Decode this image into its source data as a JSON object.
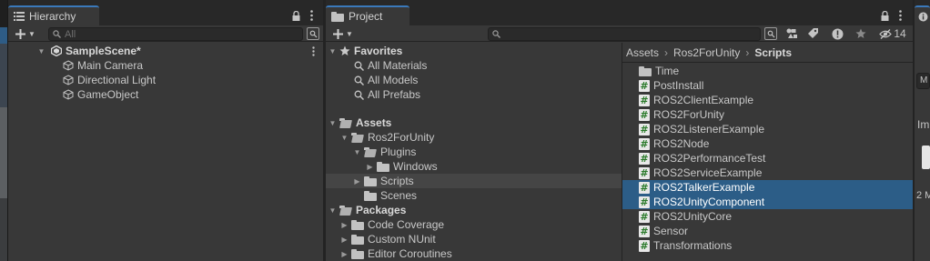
{
  "hierarchy": {
    "tab_label": "Hierarchy",
    "search_placeholder": "All",
    "scene_name": "SampleScene*",
    "objects": [
      "Main Camera",
      "Directional Light",
      "GameObject"
    ]
  },
  "project": {
    "tab_label": "Project",
    "search_value": "",
    "hidden_count": "14",
    "favorites": {
      "label": "Favorites",
      "items": [
        "All Materials",
        "All Models",
        "All Prefabs"
      ]
    },
    "assets": {
      "label": "Assets",
      "tree": {
        "ros2forunity": "Ros2ForUnity",
        "plugins": "Plugins",
        "windows": "Windows",
        "scripts": "Scripts",
        "scenes": "Scenes"
      }
    },
    "packages": {
      "label": "Packages",
      "items": [
        "Code Coverage",
        "Custom NUnit",
        "Editor Coroutines"
      ]
    },
    "breadcrumb": {
      "root": "Assets",
      "middle": "Ros2ForUnity",
      "current": "Scripts"
    },
    "files": [
      {
        "name": "Time",
        "type": "folder",
        "selected": false
      },
      {
        "name": "PostInstall",
        "type": "script",
        "selected": false
      },
      {
        "name": "ROS2ClientExample",
        "type": "script",
        "selected": false
      },
      {
        "name": "ROS2ForUnity",
        "type": "script",
        "selected": false
      },
      {
        "name": "ROS2ListenerExample",
        "type": "script",
        "selected": false
      },
      {
        "name": "ROS2Node",
        "type": "script",
        "selected": false
      },
      {
        "name": "ROS2PerformanceTest",
        "type": "script",
        "selected": false
      },
      {
        "name": "ROS2ServiceExample",
        "type": "script",
        "selected": false
      },
      {
        "name": "ROS2TalkerExample",
        "type": "script",
        "selected": true
      },
      {
        "name": "ROS2UnityComponent",
        "type": "script",
        "selected": true
      },
      {
        "name": "ROS2UnityCore",
        "type": "script",
        "selected": false
      },
      {
        "name": "Sensor",
        "type": "script",
        "selected": false
      },
      {
        "name": "Transformations",
        "type": "script",
        "selected": false
      }
    ]
  },
  "inspector": {
    "partial_labels": [
      "M",
      "Im",
      "2 M"
    ]
  },
  "colors": {
    "selection": "#2c5d87",
    "tab_accent": "#3a79bb",
    "panel": "#383838"
  }
}
